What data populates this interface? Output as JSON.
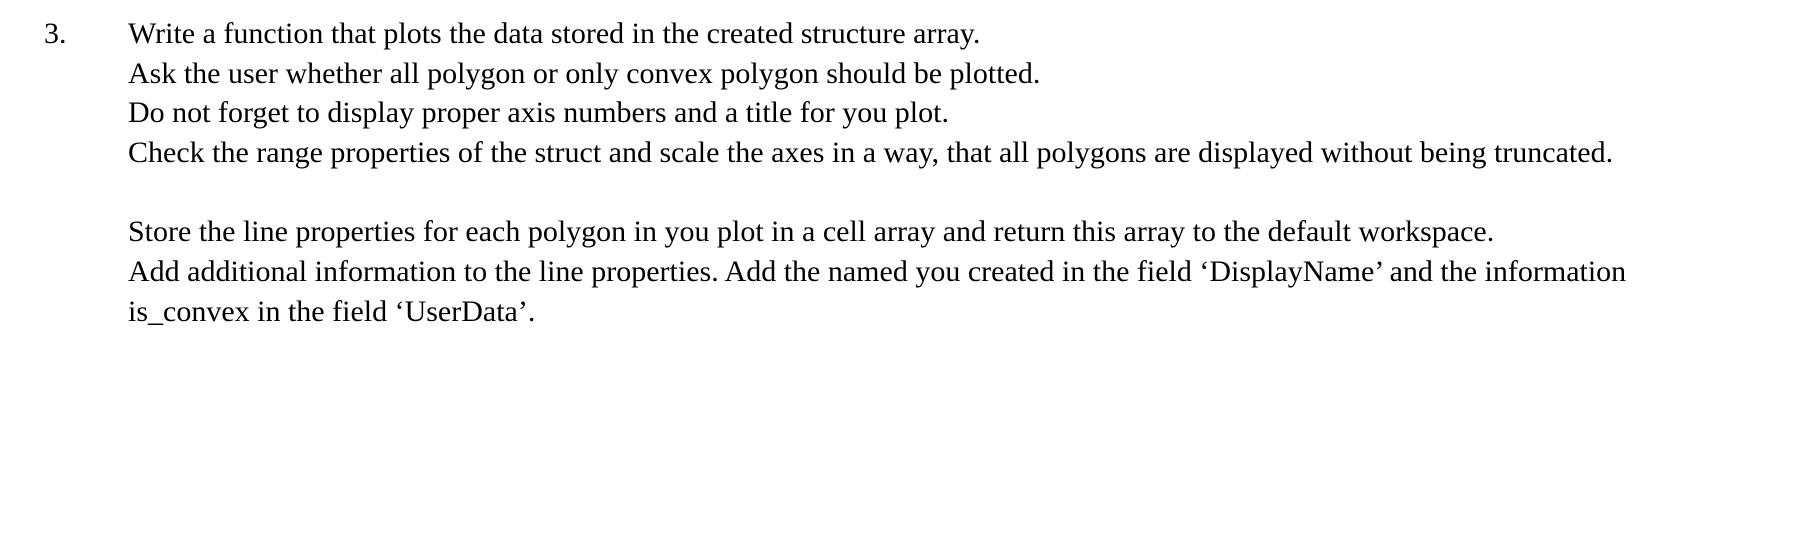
{
  "question": {
    "number": "3.",
    "paragraphs": [
      "Write a function that plots the data stored in the created structure array.\nAsk the user whether all polygon or only convex polygon should be plotted.\nDo not forget to display proper axis numbers and a title for you plot.\nCheck the range properties of the struct and scale the axes in a way, that all polygons are displayed without being truncated.",
      "Store the line properties for each polygon in you plot in a cell array and return this array to the default workspace.\nAdd additional information to the line properties. Add the named you created in the field ‘DisplayName’ and the information is_convex in the field ‘UserData’."
    ]
  }
}
